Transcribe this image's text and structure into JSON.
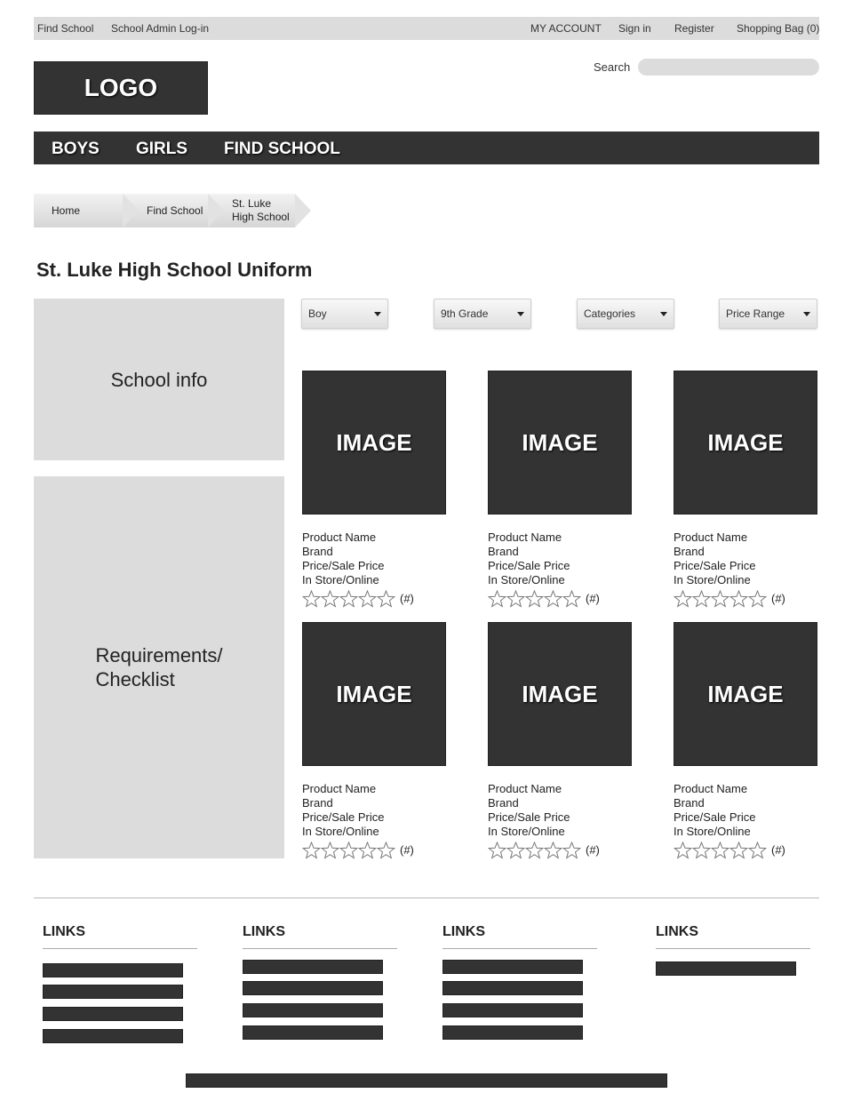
{
  "topbar": {
    "find_school": "Find School",
    "school_admin_login": "School Admin Log-in",
    "my_account": "MY ACCOUNT",
    "sign_in": "Sign in",
    "register": "Register",
    "shopping_bag": "Shopping Bag (0)"
  },
  "logo": {
    "text": "LOGO"
  },
  "search": {
    "label": "Search",
    "placeholder": ""
  },
  "nav": {
    "boys": "BOYS",
    "girls": "GIRLS",
    "find_school": "FIND SCHOOL"
  },
  "breadcrumb": {
    "home": "Home",
    "find_school": "Find School",
    "school_line1": "St. Luke",
    "school_line2": "High School"
  },
  "page": {
    "title": "St. Luke High School Uniform"
  },
  "sidebar": {
    "school_info": "School info",
    "requirements": "Requirements/\nChecklist"
  },
  "filters": {
    "gender": "Boy",
    "grade": "9th Grade",
    "categories": "Categories",
    "price_range": "Price Range"
  },
  "products": [
    {
      "image_label": "IMAGE",
      "name": "Product Name",
      "brand": "Brand",
      "price": "Price/Sale Price",
      "availability": "In Store/Online",
      "rating_count": "(#)",
      "rating": 0
    },
    {
      "image_label": "IMAGE",
      "name": "Product Name",
      "brand": "Brand",
      "price": "Price/Sale Price",
      "availability": "In Store/Online",
      "rating_count": "(#)",
      "rating": 0
    },
    {
      "image_label": "IMAGE",
      "name": "Product Name",
      "brand": "Brand",
      "price": "Price/Sale Price",
      "availability": "In Store/Online",
      "rating_count": "(#)",
      "rating": 0
    },
    {
      "image_label": "IMAGE",
      "name": "Product Name",
      "brand": "Brand",
      "price": "Price/Sale Price",
      "availability": "In Store/Online",
      "rating_count": "(#)",
      "rating": 0
    },
    {
      "image_label": "IMAGE",
      "name": "Product Name",
      "brand": "Brand",
      "price": "Price/Sale Price",
      "availability": "In Store/Online",
      "rating_count": "(#)",
      "rating": 0
    },
    {
      "image_label": "IMAGE",
      "name": "Product Name",
      "brand": "Brand",
      "price": "Price/Sale Price",
      "availability": "In Store/Online",
      "rating_count": "(#)",
      "rating": 0
    }
  ],
  "footer": {
    "columns": [
      {
        "heading": "LINKS"
      },
      {
        "heading": "LINKS"
      },
      {
        "heading": "LINKS"
      },
      {
        "heading": "LINKS"
      }
    ]
  },
  "colors": {
    "dark_block": "#333333",
    "light_panel": "#dcdcdc",
    "text": "#222222"
  }
}
